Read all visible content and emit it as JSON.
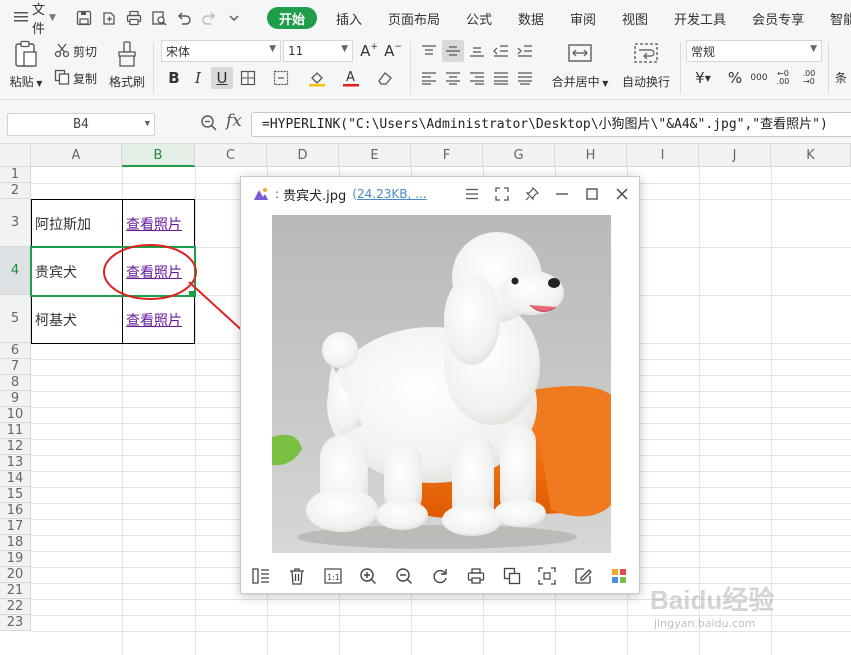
{
  "menubar": {
    "file_label": "文件",
    "tabs": [
      "开始",
      "插入",
      "页面布局",
      "公式",
      "数据",
      "审阅",
      "视图",
      "开发工具",
      "会员专享",
      "智能工具"
    ]
  },
  "ribbon": {
    "paste": "粘贴",
    "cut": "剪切",
    "copy": "复制",
    "format_painter": "格式刷",
    "font_name": "宋体",
    "font_size": "11",
    "merge_center": "合并居中",
    "wrap_text": "自动换行",
    "number_format": "常规",
    "more": "条"
  },
  "formula_bar": {
    "name_box": "B4",
    "fx": "fx",
    "formula": "=HYPERLINK(\"C:\\Users\\Administrator\\Desktop\\小狗图片\\\"&A4&\".jpg\",\"查看照片\")"
  },
  "grid": {
    "columns": [
      "A",
      "B",
      "C",
      "D",
      "E",
      "F",
      "G",
      "H",
      "I",
      "J",
      "K"
    ],
    "rows": [
      "1",
      "2",
      "3",
      "4",
      "5",
      "6",
      "7",
      "8",
      "9",
      "10",
      "11",
      "12",
      "13",
      "14",
      "15",
      "16",
      "17",
      "18",
      "19",
      "20",
      "21",
      "22",
      "23"
    ],
    "table": [
      {
        "name": "阿拉斯加",
        "link": "查看照片"
      },
      {
        "name": "贵宾犬",
        "link": "查看照片"
      },
      {
        "name": "柯基犬",
        "link": "查看照片"
      }
    ]
  },
  "viewer": {
    "file_name": "贵宾犬.jpg",
    "file_size": "24.23KB",
    "file_meta_rest": ", ..."
  },
  "watermark": {
    "brand": "Baidu经验",
    "url": "jingyan.baidu.com"
  },
  "colors": {
    "accent_green": "#1e9d4a",
    "link_purple": "#6a1b9a",
    "annotation_red": "#e02020"
  }
}
